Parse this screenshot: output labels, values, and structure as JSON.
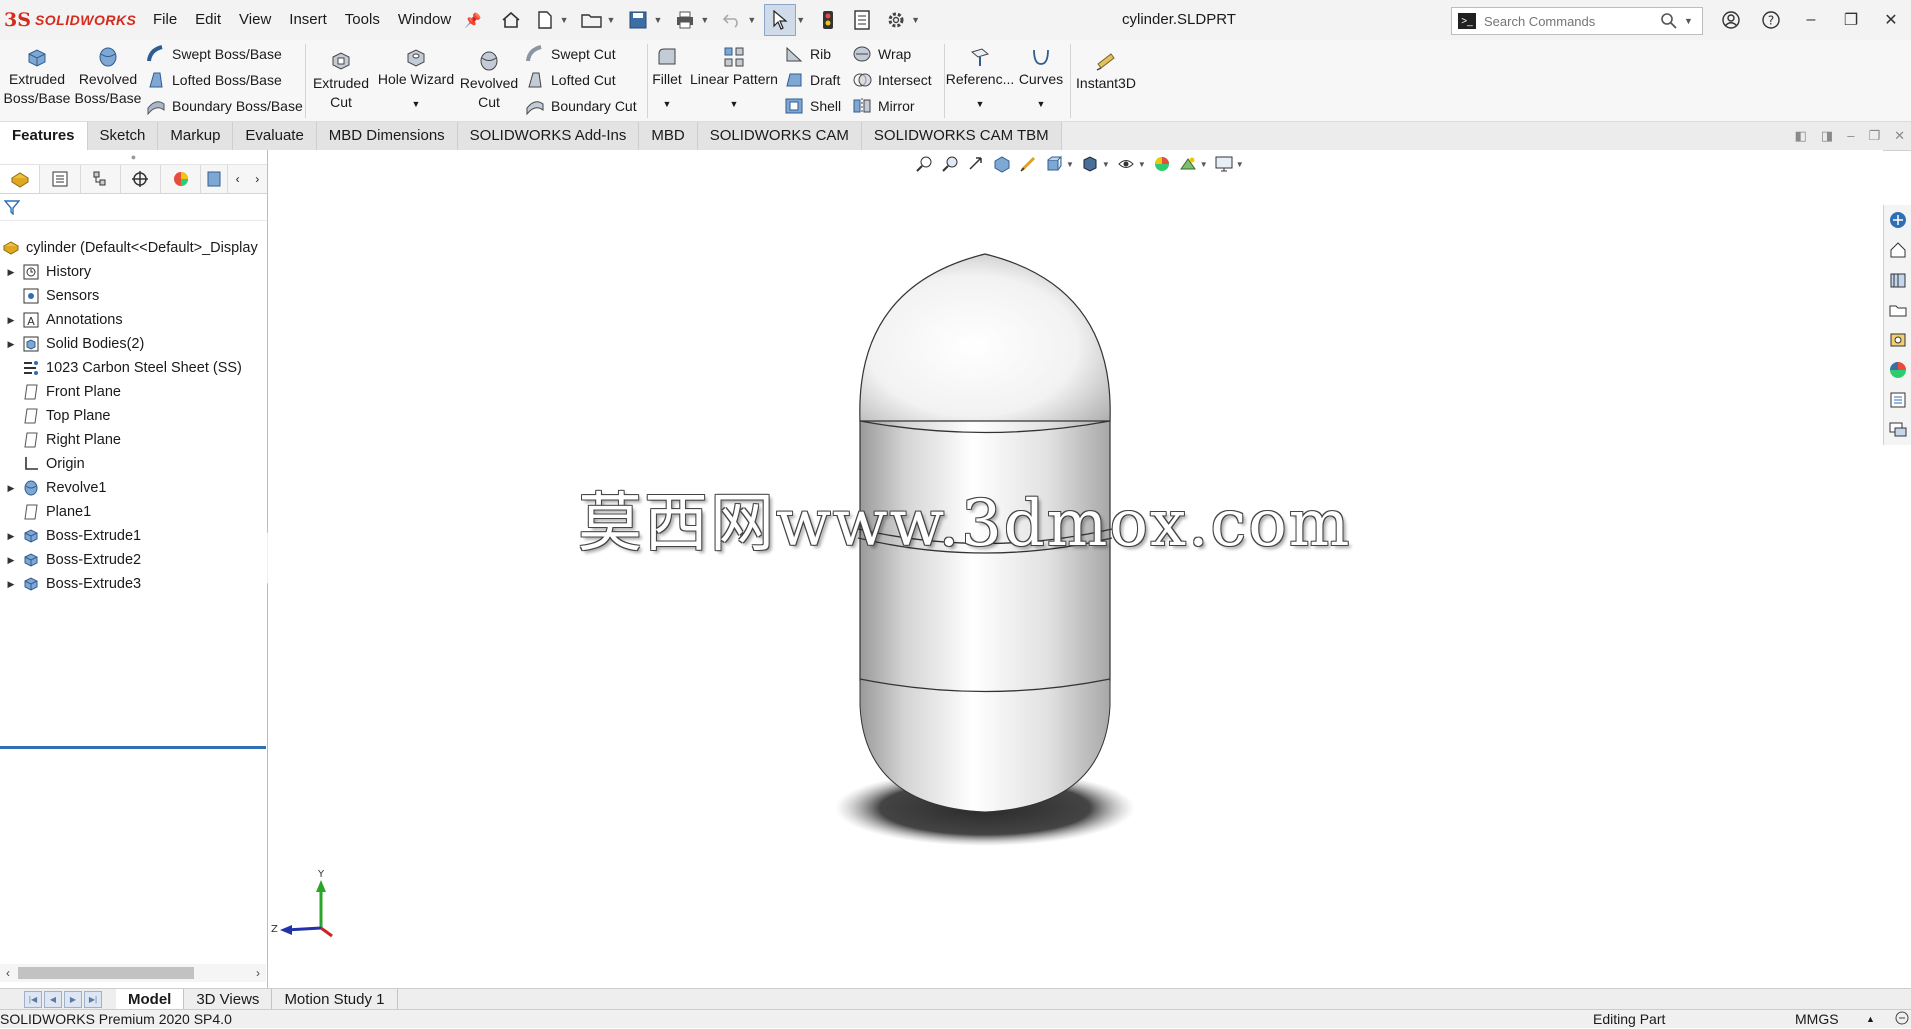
{
  "app": {
    "brand": "SOLIDWORKS",
    "document_title": "cylinder.SLDPRT",
    "menus": [
      "File",
      "Edit",
      "View",
      "Insert",
      "Tools",
      "Window"
    ],
    "search_placeholder": "Search Commands"
  },
  "command_manager": {
    "extruded_boss_line1": "Extruded",
    "extruded_boss_line2": "Boss/Base",
    "revolved_boss_line1": "Revolved",
    "revolved_boss_line2": "Boss/Base",
    "swept_boss": "Swept Boss/Base",
    "lofted_boss": "Lofted Boss/Base",
    "boundary_boss": "Boundary Boss/Base",
    "extruded_cut_line1": "Extruded",
    "extruded_cut_line2": "Cut",
    "hole_wizard": "Hole Wizard",
    "revolved_cut_line1": "Revolved",
    "revolved_cut_line2": "Cut",
    "swept_cut": "Swept Cut",
    "lofted_cut": "Lofted Cut",
    "boundary_cut": "Boundary Cut",
    "fillet": "Fillet",
    "linear_pattern": "Linear Pattern",
    "rib": "Rib",
    "draft": "Draft",
    "shell": "Shell",
    "wrap": "Wrap",
    "intersect": "Intersect",
    "mirror": "Mirror",
    "reference": "Referenc...",
    "curves": "Curves",
    "instant3d": "Instant3D"
  },
  "tabs": [
    "Features",
    "Sketch",
    "Markup",
    "Evaluate",
    "MBD Dimensions",
    "SOLIDWORKS Add-Ins",
    "MBD",
    "SOLIDWORKS CAM",
    "SOLIDWORKS CAM TBM"
  ],
  "active_tab": "Features",
  "feature_tree": {
    "root": "cylinder  (Default<<Default>_Display",
    "items": [
      {
        "label": "History",
        "expandable": true,
        "icon": "history-icon"
      },
      {
        "label": "Sensors",
        "expandable": false,
        "icon": "sensors-icon"
      },
      {
        "label": "Annotations",
        "expandable": true,
        "icon": "annotations-icon"
      },
      {
        "label": "Solid Bodies(2)",
        "expandable": true,
        "icon": "solid-bodies-icon"
      },
      {
        "label": "1023 Carbon Steel Sheet (SS)",
        "expandable": false,
        "icon": "material-icon"
      },
      {
        "label": "Front Plane",
        "expandable": false,
        "icon": "plane-icon"
      },
      {
        "label": "Top Plane",
        "expandable": false,
        "icon": "plane-icon"
      },
      {
        "label": "Right Plane",
        "expandable": false,
        "icon": "plane-icon"
      },
      {
        "label": "Origin",
        "expandable": false,
        "icon": "origin-icon"
      },
      {
        "label": "Revolve1",
        "expandable": true,
        "icon": "revolve-icon"
      },
      {
        "label": "Plane1",
        "expandable": false,
        "icon": "plane-icon"
      },
      {
        "label": "Boss-Extrude1",
        "expandable": true,
        "icon": "extrude-icon"
      },
      {
        "label": "Boss-Extrude2",
        "expandable": true,
        "icon": "extrude-icon"
      },
      {
        "label": "Boss-Extrude3",
        "expandable": true,
        "icon": "extrude-icon"
      }
    ]
  },
  "viewport": {
    "watermark": "莫西网www.3dmox.com",
    "triad_y": "Y",
    "triad_z": "Z"
  },
  "bottom_tabs": [
    "Model",
    "3D Views",
    "Motion Study 1"
  ],
  "active_bottom_tab": "Model",
  "status": {
    "version": "SOLIDWORKS Premium 2020 SP4.0",
    "mode": "Editing Part",
    "units": "MMGS"
  },
  "colors": {
    "brand_red": "#d52b1e",
    "rollback_bar": "#2f6fb3",
    "accent_blue": "#2f6fb3"
  }
}
